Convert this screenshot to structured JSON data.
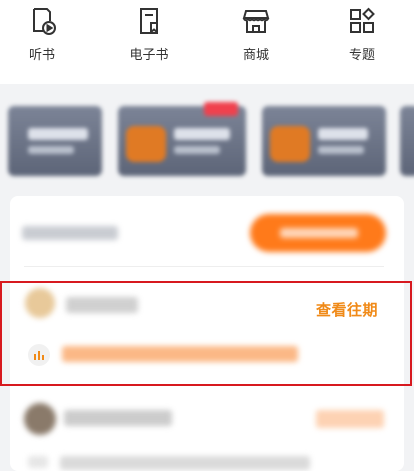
{
  "nav": {
    "items": [
      {
        "label": "听书",
        "icon": "audiobook-icon"
      },
      {
        "label": "电子书",
        "icon": "ebook-icon"
      },
      {
        "label": "商城",
        "icon": "store-icon"
      },
      {
        "label": "专题",
        "icon": "topics-grid-icon"
      }
    ]
  },
  "featured": {
    "view_past_label": "查看往期",
    "audio_icon": "audio-bars-icon"
  },
  "colors": {
    "accent": "#f08a18",
    "button_orange": "#ff7a1a",
    "highlight_border": "#d7191f"
  }
}
